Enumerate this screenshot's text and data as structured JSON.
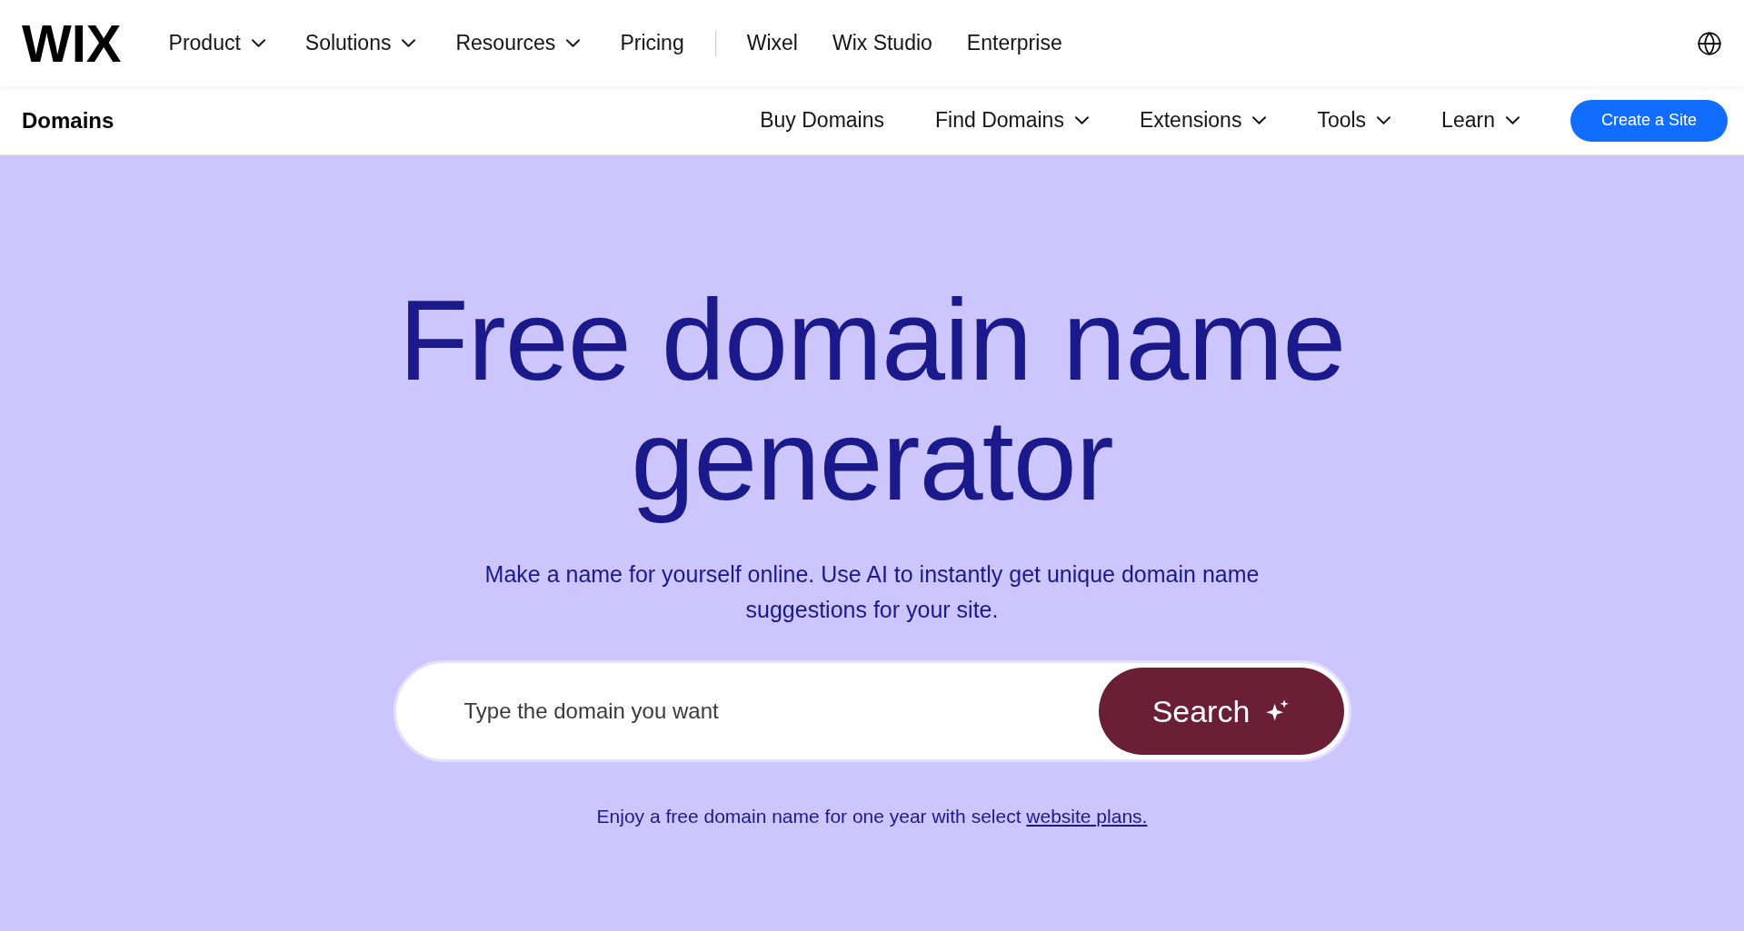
{
  "logo": "WIX",
  "top_nav": [
    {
      "label": "Product",
      "dropdown": true
    },
    {
      "label": "Solutions",
      "dropdown": true
    },
    {
      "label": "Resources",
      "dropdown": true
    },
    {
      "label": "Pricing",
      "dropdown": false
    }
  ],
  "top_nav_secondary": [
    "Wixel",
    "Wix Studio",
    "Enterprise"
  ],
  "sub_header": {
    "title": "Domains",
    "nav": [
      {
        "label": "Buy Domains",
        "dropdown": false
      },
      {
        "label": "Find Domains",
        "dropdown": true
      },
      {
        "label": "Extensions",
        "dropdown": true
      },
      {
        "label": "Tools",
        "dropdown": true
      },
      {
        "label": "Learn",
        "dropdown": true
      }
    ],
    "cta": "Create a Site"
  },
  "hero": {
    "title_lines": [
      "Free domain name",
      "generator"
    ],
    "subtitle_lines": [
      "Make a name for yourself online. Use AI to instantly get unique domain name",
      "suggestions for your site."
    ],
    "search": {
      "placeholder": "Type the domain you want",
      "button": "Search"
    },
    "note": {
      "text": "Enjoy a free domain name for one year with select ",
      "link": "website plans."
    }
  }
}
